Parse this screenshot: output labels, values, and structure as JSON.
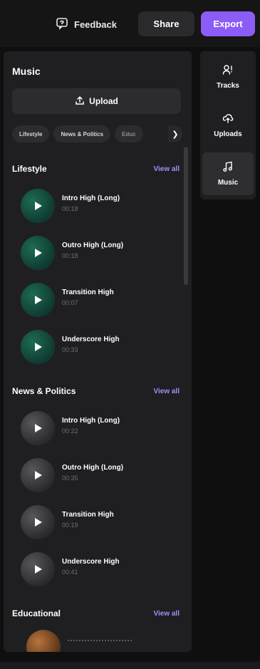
{
  "header": {
    "feedback_label": "Feedback",
    "share_label": "Share",
    "export_label": "Export"
  },
  "panel": {
    "title": "Music",
    "upload_label": "Upload",
    "chips": [
      "Lifestyle",
      "News & Politics",
      "Educ"
    ],
    "chips_next_icon": "chevron-right-icon"
  },
  "sections": [
    {
      "title": "Lifestyle",
      "view_all": "View all",
      "color": "teal",
      "tracks": [
        {
          "name": "Intro High (Long)",
          "duration": "00:18"
        },
        {
          "name": "Outro High (Long)",
          "duration": "00:18"
        },
        {
          "name": "Transition High",
          "duration": "00:07"
        },
        {
          "name": "Underscore High",
          "duration": "00:33"
        }
      ]
    },
    {
      "title": "News & Politics",
      "view_all": "View all",
      "color": "gray",
      "tracks": [
        {
          "name": "Intro High (Long)",
          "duration": "00:22"
        },
        {
          "name": "Outro High (Long)",
          "duration": "00:35"
        },
        {
          "name": "Transition High",
          "duration": "00:19"
        },
        {
          "name": "Underscore High",
          "duration": "00:41"
        }
      ]
    },
    {
      "title": "Educational",
      "view_all": "View all",
      "color": "brown"
    }
  ],
  "nav": {
    "items": [
      {
        "label": "Tracks",
        "icon": "tracks-icon",
        "active": false
      },
      {
        "label": "Uploads",
        "icon": "cloud-upload-icon",
        "active": false
      },
      {
        "label": "Music",
        "icon": "music-note-icon",
        "active": true
      }
    ]
  },
  "colors": {
    "accent": "#8b5cf6",
    "view_all": "#a78bfa",
    "panel_bg": "#1f1f21",
    "app_bg": "#0f0f10"
  }
}
